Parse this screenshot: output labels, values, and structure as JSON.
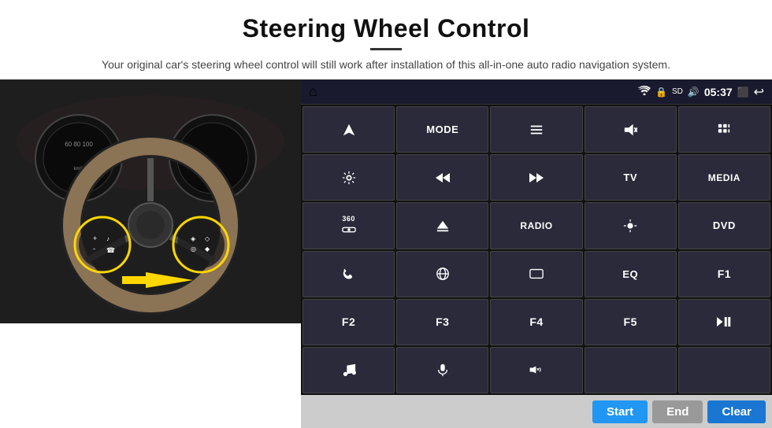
{
  "header": {
    "title": "Steering Wheel Control",
    "subtitle": "Your original car's steering wheel control will still work after installation of this all-in-one auto radio navigation system."
  },
  "status_bar": {
    "home_icon": "⌂",
    "wifi_icon": "wifi",
    "lock_icon": "lock",
    "sd_icon": "sd",
    "bt_icon": "bt",
    "time": "05:37",
    "screen_icon": "screen",
    "back_icon": "back"
  },
  "buttons": [
    {
      "label": "",
      "icon": "navigate",
      "row": 1,
      "col": 1
    },
    {
      "label": "MODE",
      "icon": "",
      "row": 1,
      "col": 2
    },
    {
      "label": "",
      "icon": "list",
      "row": 1,
      "col": 3
    },
    {
      "label": "",
      "icon": "mute",
      "row": 1,
      "col": 4
    },
    {
      "label": "",
      "icon": "apps",
      "row": 1,
      "col": 5
    },
    {
      "label": "",
      "icon": "settings",
      "row": 2,
      "col": 1
    },
    {
      "label": "",
      "icon": "prev",
      "row": 2,
      "col": 2
    },
    {
      "label": "",
      "icon": "next",
      "row": 2,
      "col": 3
    },
    {
      "label": "TV",
      "icon": "",
      "row": 2,
      "col": 4
    },
    {
      "label": "MEDIA",
      "icon": "",
      "row": 2,
      "col": 5
    },
    {
      "label": "",
      "icon": "360cam",
      "row": 3,
      "col": 1
    },
    {
      "label": "",
      "icon": "eject",
      "row": 3,
      "col": 2
    },
    {
      "label": "RADIO",
      "icon": "",
      "row": 3,
      "col": 3
    },
    {
      "label": "",
      "icon": "brightness",
      "row": 3,
      "col": 4
    },
    {
      "label": "DVD",
      "icon": "",
      "row": 3,
      "col": 5
    },
    {
      "label": "",
      "icon": "phone",
      "row": 4,
      "col": 1
    },
    {
      "label": "",
      "icon": "browse",
      "row": 4,
      "col": 2
    },
    {
      "label": "",
      "icon": "rect",
      "row": 4,
      "col": 3
    },
    {
      "label": "EQ",
      "icon": "",
      "row": 4,
      "col": 4
    },
    {
      "label": "F1",
      "icon": "",
      "row": 4,
      "col": 5
    },
    {
      "label": "F2",
      "icon": "",
      "row": 5,
      "col": 1
    },
    {
      "label": "F3",
      "icon": "",
      "row": 5,
      "col": 2
    },
    {
      "label": "F4",
      "icon": "",
      "row": 5,
      "col": 3
    },
    {
      "label": "F5",
      "icon": "",
      "row": 5,
      "col": 4
    },
    {
      "label": "",
      "icon": "playpause",
      "row": 5,
      "col": 5
    },
    {
      "label": "",
      "icon": "music",
      "row": 6,
      "col": 1
    },
    {
      "label": "",
      "icon": "mic",
      "row": 6,
      "col": 2
    },
    {
      "label": "",
      "icon": "volphone",
      "row": 6,
      "col": 3
    },
    {
      "label": "",
      "icon": "",
      "row": 6,
      "col": 4
    },
    {
      "label": "",
      "icon": "",
      "row": 6,
      "col": 5
    }
  ],
  "actions": {
    "start_label": "Start",
    "end_label": "End",
    "clear_label": "Clear"
  }
}
